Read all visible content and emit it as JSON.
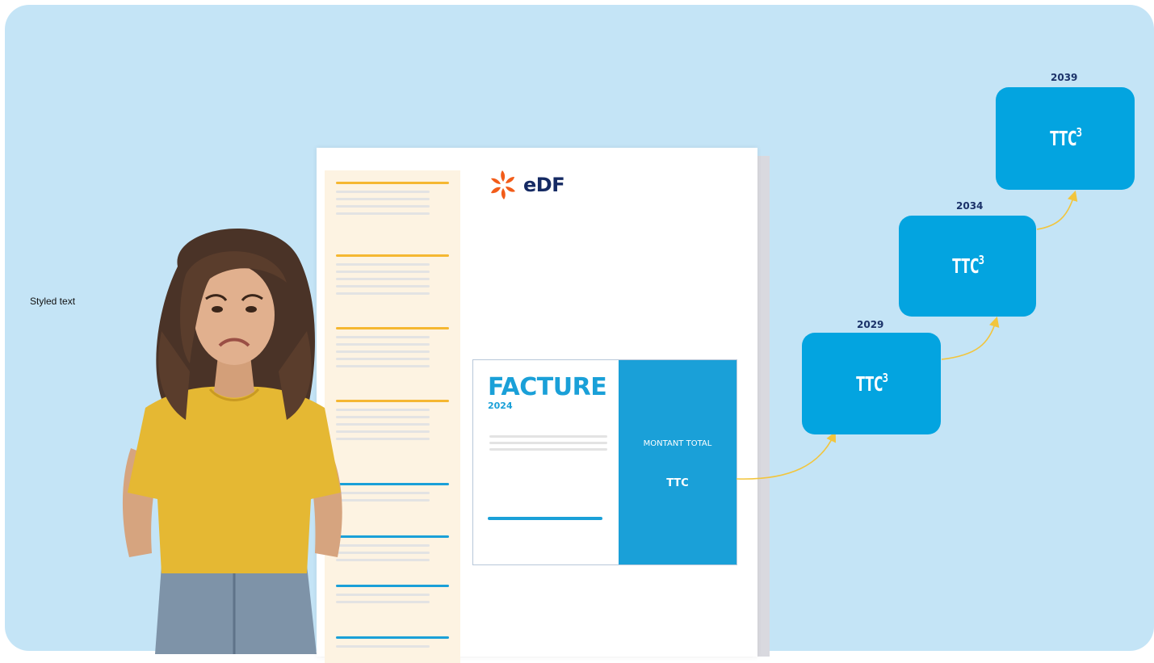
{
  "styled_text": "Styled text",
  "invoice": {
    "brand": "eDF",
    "title": "FACTURE",
    "year": "2024",
    "amount_label": "MONTANT TOTAL",
    "amount_value": "TTC"
  },
  "timeline": [
    {
      "year": "2029",
      "label": "TTC",
      "exponent": "3"
    },
    {
      "year": "2034",
      "label": "TTC",
      "exponent": "3"
    },
    {
      "year": "2039",
      "label": "TTC",
      "exponent": "3"
    }
  ],
  "colors": {
    "background": "#c4e4f6",
    "accent_blue": "#03a4e0",
    "edf_orange": "#f25c19",
    "edf_navy": "#152a63",
    "arrow_yellow": "#f2c53d",
    "side_yellow": "#f5b731"
  }
}
